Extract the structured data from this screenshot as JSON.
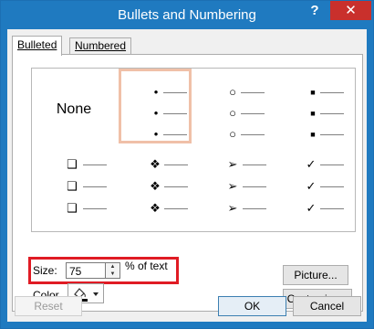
{
  "window": {
    "title": "Bullets and Numbering",
    "help_glyph": "?",
    "close_glyph": "✕"
  },
  "tabs": [
    {
      "label": "Bulleted",
      "active": true
    },
    {
      "label": "Numbered",
      "active": false
    }
  ],
  "gallery": {
    "none_label": "None",
    "styles": [
      {
        "name": "none",
        "symbol": ""
      },
      {
        "name": "small-dot",
        "symbol": "•"
      },
      {
        "name": "hollow-circle",
        "symbol": "○"
      },
      {
        "name": "filled-square",
        "symbol": "■"
      },
      {
        "name": "hollow-square",
        "symbol": "❑"
      },
      {
        "name": "four-diamond",
        "symbol": "❖"
      },
      {
        "name": "arrowhead",
        "symbol": "➢"
      },
      {
        "name": "checkmark",
        "symbol": "✓"
      }
    ],
    "selected": "small-dot"
  },
  "size": {
    "label": "Size:",
    "value": "75",
    "suffix": "% of text"
  },
  "color": {
    "label": "Color",
    "swatch": "#000000"
  },
  "buttons": {
    "picture": "Picture...",
    "customize": "Customize...",
    "reset": "Reset",
    "ok": "OK",
    "cancel": "Cancel"
  },
  "colors": {
    "titlebar": "#1f7ac0",
    "close": "#c9302c",
    "highlight": "#e01b24",
    "selection": "#f0c0a8"
  }
}
